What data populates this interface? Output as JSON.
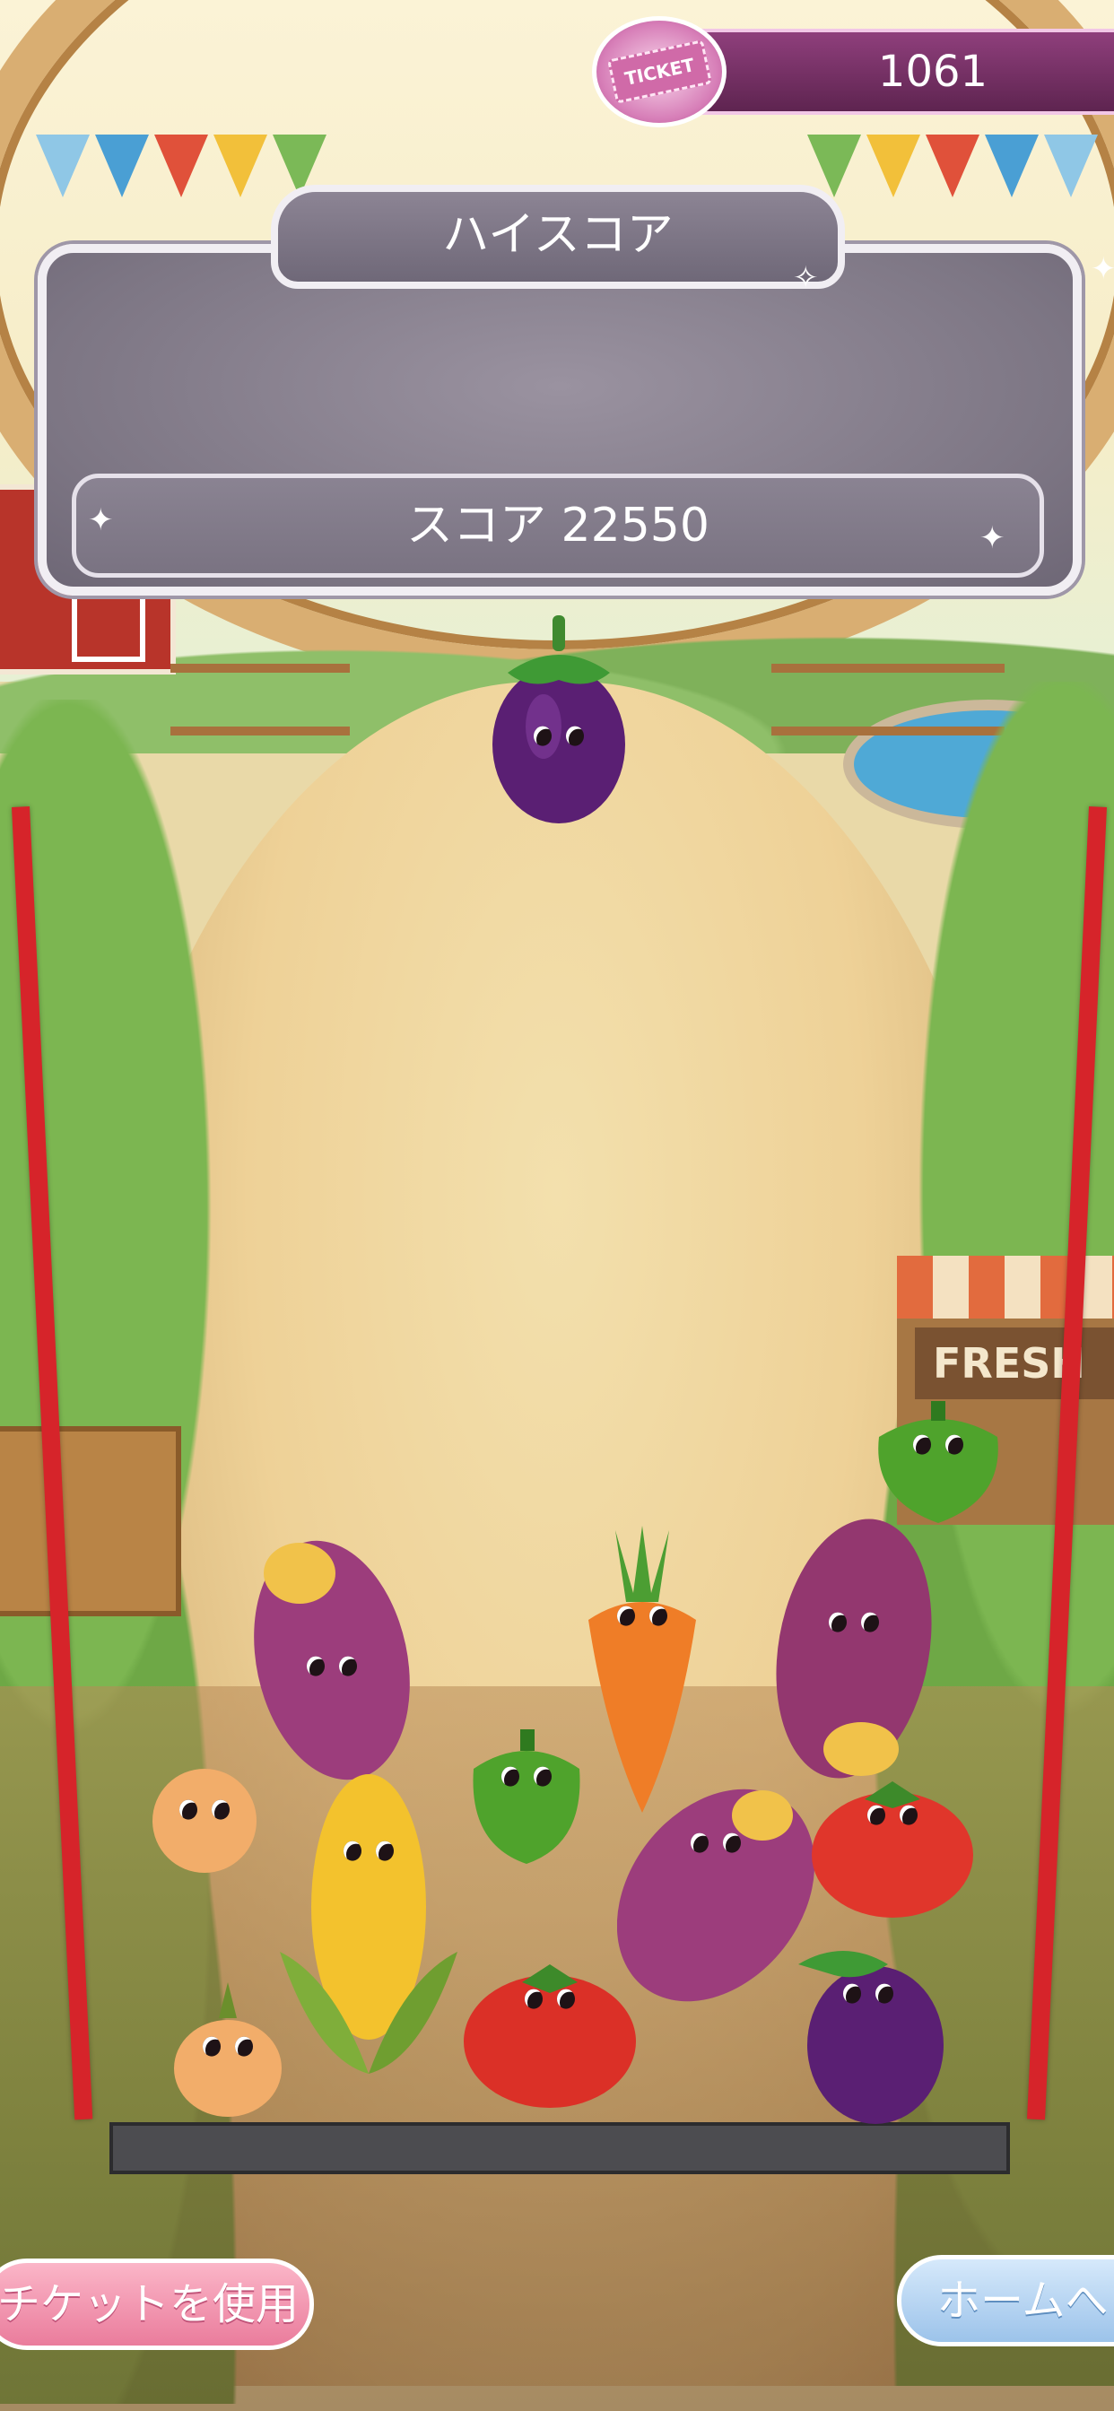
{
  "hud": {
    "ticket_count": "1061",
    "ticket_icon_label": "TICKET",
    "high_score_label": "ハイスコア",
    "score_label": "スコア 22550"
  },
  "scene": {
    "stand_sign": "FRESH"
  },
  "buttons": {
    "use_ticket": "チケットを使用",
    "home": "ホームへ"
  },
  "colors": {
    "container_wall": "#d6242a",
    "container_floor": "#4c4c50",
    "panel": "#7d7684",
    "ticket_bar": "#5e2450",
    "use_ticket_button": "#ea7c9c",
    "home_button": "#9cc3ea"
  },
  "pieces": {
    "next": "eggplant",
    "in_container": [
      "sweet-potato",
      "carrot",
      "sweet-potato",
      "green-pepper",
      "onion",
      "green-pepper",
      "corn",
      "sweet-potato",
      "tomato",
      "tomato",
      "onion",
      "eggplant"
    ]
  }
}
